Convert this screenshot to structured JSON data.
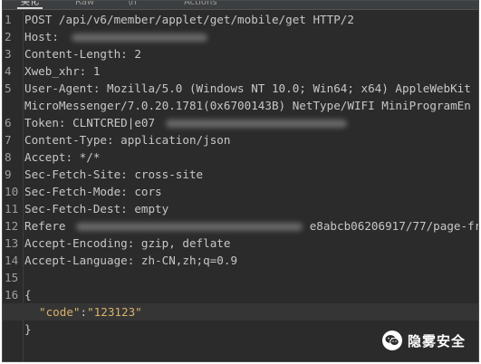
{
  "tabs": [
    {
      "label": "美化",
      "active": true
    },
    {
      "label": "Raw",
      "active": false
    },
    {
      "label": "\\n",
      "active": false
    },
    {
      "label": "Actions",
      "active": false
    }
  ],
  "request": {
    "line1": "POST /api/v6/member/applet/get/mobile/get HTTP/2",
    "host_key": "Host:",
    "content_length": "Content-Length: 2",
    "xweb_xhr": "Xweb_xhr: 1",
    "user_agent": "User-Agent: Mozilla/5.0 (Windows NT 10.0; Win64; x64) AppleWebKit",
    "user_agent_cont": "MicroMessenger/7.0.20.1781(0x6700143B) NetType/WIFI MiniProgramEn",
    "token_prefix": "Token: CLNTCRED|e07",
    "content_type": "Content-Type: application/json",
    "accept": "Accept: */*",
    "sec_fetch_site": "Sec-Fetch-Site: cross-site",
    "sec_fetch_mode": "Sec-Fetch-Mode: cors",
    "sec_fetch_dest": "Sec-Fetch-Dest: empty",
    "referer_prefix": "Refere",
    "referer_suffix": "e8abcb06206917/77/page-fra",
    "accept_encoding": "Accept-Encoding: gzip, deflate",
    "accept_language": "Accept-Language: zh-CN,zh;q=0.9",
    "body_open": "{",
    "body_key": "\"code\"",
    "body_colon": ":",
    "body_value": "\"123123\"",
    "body_close": "}"
  },
  "line_numbers": [
    "1",
    "2",
    "3",
    "4",
    "5",
    "",
    "6",
    "7",
    "8",
    "9",
    "10",
    "11",
    "12",
    "13",
    "14",
    "15",
    "16",
    "",
    ""
  ],
  "watermark": {
    "text": "隐雾安全",
    "icon": "wechat-icon"
  },
  "colors": {
    "background": "#2b2b2b",
    "text": "#c7c7c7",
    "json_string": "#d8b26a",
    "line_number": "#a0a0a0"
  }
}
